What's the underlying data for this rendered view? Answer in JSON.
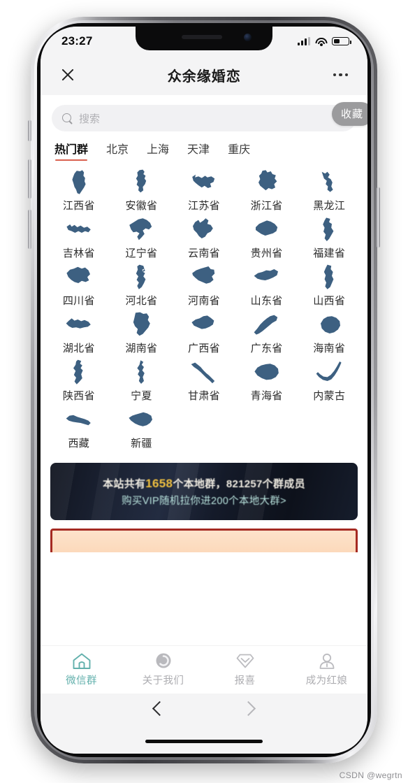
{
  "status_bar": {
    "time": "23:27",
    "signal_icon": "signal-bars-icon",
    "wifi_icon": "wifi-icon",
    "battery_icon": "battery-icon"
  },
  "app_header": {
    "close_icon": "close-icon",
    "title": "众余缘婚恋",
    "more_icon": "more-options-icon"
  },
  "search": {
    "icon": "search-icon",
    "placeholder": "搜索",
    "value": ""
  },
  "favorite_button": {
    "label": "收藏"
  },
  "tabs": {
    "active_index": 0,
    "items": [
      {
        "label": "热门群"
      },
      {
        "label": "北京"
      },
      {
        "label": "上海"
      },
      {
        "label": "天津"
      },
      {
        "label": "重庆"
      }
    ],
    "active_underline_color": "#d9614f"
  },
  "provinces": {
    "shape_color": "#3d6081",
    "items": [
      {
        "name": "江西省"
      },
      {
        "name": "安徽省"
      },
      {
        "name": "江苏省"
      },
      {
        "name": "浙江省"
      },
      {
        "name": "黑龙江"
      },
      {
        "name": "吉林省"
      },
      {
        "name": "辽宁省"
      },
      {
        "name": "云南省"
      },
      {
        "name": "贵州省"
      },
      {
        "name": "福建省"
      },
      {
        "name": "四川省"
      },
      {
        "name": "河北省"
      },
      {
        "name": "河南省"
      },
      {
        "name": "山东省"
      },
      {
        "name": "山西省"
      },
      {
        "name": "湖北省"
      },
      {
        "name": "湖南省"
      },
      {
        "name": "广西省"
      },
      {
        "name": "广东省"
      },
      {
        "name": "海南省"
      },
      {
        "name": "陕西省"
      },
      {
        "name": "宁夏"
      },
      {
        "name": "甘肃省"
      },
      {
        "name": "青海省"
      },
      {
        "name": "内蒙古"
      },
      {
        "name": "西藏"
      },
      {
        "name": "新疆"
      }
    ]
  },
  "banner": {
    "line1_prefix": "本站共有",
    "line1_highlight": "1658",
    "line1_suffix": "个本地群，821257个群成员",
    "line1_highlight_color": "#f0c040",
    "line2": "购买VIP随机拉你进200个本地大群>",
    "line2_color": "#b9e3dd",
    "group_count": "1658",
    "member_count": "821257"
  },
  "tabbar": {
    "active_index": 0,
    "active_color": "#62b0ac",
    "inactive_color": "#adadb1",
    "items": [
      {
        "label": "微信群",
        "icon": "home-icon"
      },
      {
        "label": "关于我们",
        "icon": "info-circle-icon"
      },
      {
        "label": "报喜",
        "icon": "diamond-icon"
      },
      {
        "label": "成为红娘",
        "icon": "person-icon"
      }
    ]
  },
  "browser_bar": {
    "back_icon": "chevron-left-icon",
    "forward_icon": "chevron-right-icon"
  },
  "watermark": {
    "text": "CSDN @wegrtn"
  }
}
